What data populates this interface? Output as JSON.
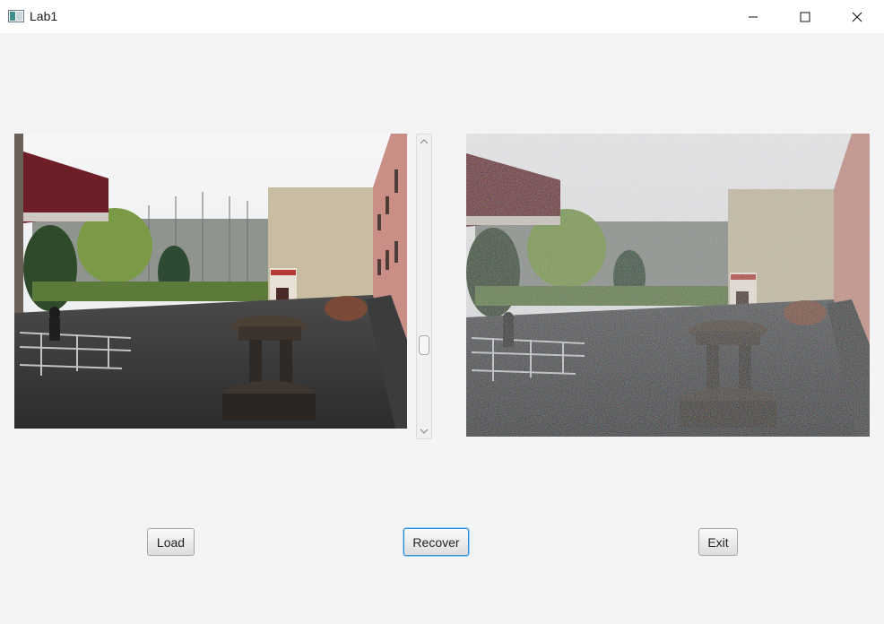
{
  "window": {
    "title": "Lab1",
    "icon": "java-app-icon",
    "controls": {
      "minimize_icon": "minimize-icon",
      "maximize_icon": "maximize-icon",
      "close_icon": "close-icon"
    }
  },
  "images": {
    "left": {
      "name": "original-image",
      "content": "courtyard-photo"
    },
    "right": {
      "name": "noisy-image",
      "content": "courtyard-photo-with-noise"
    }
  },
  "scrollbar": {
    "orientation": "vertical",
    "up_icon": "chevron-up-icon",
    "down_icon": "chevron-down-icon",
    "value_fraction": 0.73
  },
  "buttons": {
    "load_label": "Load",
    "recover_label": "Recover",
    "exit_label": "Exit"
  },
  "colors": {
    "background": "#f4f4f4",
    "focus_border": "#2a8fd8"
  }
}
